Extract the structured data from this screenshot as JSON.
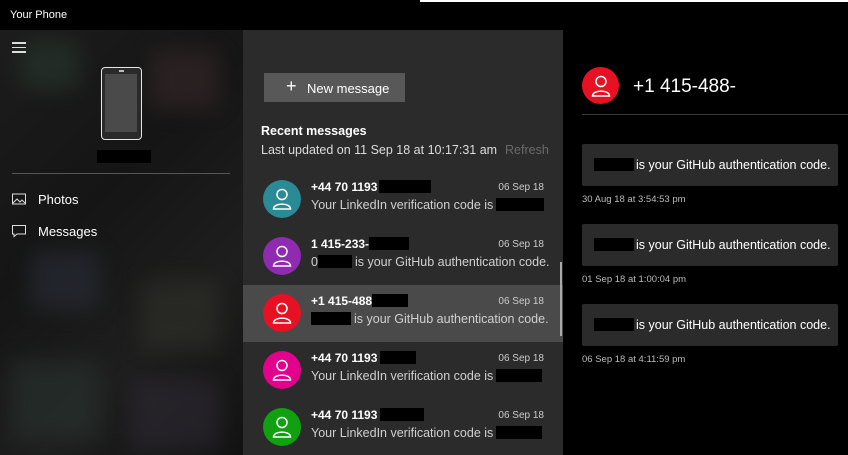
{
  "app": {
    "title": "Your Phone"
  },
  "nav": {
    "items": [
      {
        "label": "Photos",
        "icon": "photos-icon"
      },
      {
        "label": "Messages",
        "icon": "messages-icon"
      }
    ]
  },
  "messages_pane": {
    "new_message_label": "New message",
    "recent_title": "Recent messages",
    "last_updated": "Last updated on 11 Sep 18 at 10:17:31 am",
    "refresh_label": "Refresh",
    "conversations": [
      {
        "name": "+44 70 1193",
        "date": "06 Sep 18",
        "preview": "Your LinkedIn verification code is",
        "preview_suffix": "",
        "avatar_color": "#2a8a96"
      },
      {
        "name": "1 415-233-",
        "date": "06 Sep 18",
        "preview_prefix": "0",
        "preview": "is your GitHub authentication code.",
        "avatar_color": "#8e2bb0"
      },
      {
        "name": "+1 415-488",
        "date": "06 Sep 18",
        "preview": "is your GitHub authentication code.",
        "avatar_color": "#e81123",
        "selected": true
      },
      {
        "name": "+44 70 1193",
        "date": "06 Sep 18",
        "preview": "Your LinkedIn verification code is",
        "avatar_color": "#e3008c"
      },
      {
        "name": "+44 70 1193",
        "date": "06 Sep 18",
        "preview": "Your LinkedIn verification code is",
        "avatar_color": "#10a010"
      }
    ]
  },
  "conversation": {
    "contact": "+1 415-488-",
    "avatar_color": "#e81123",
    "messages": [
      {
        "text": "is your GitHub authentication code.",
        "timestamp": "30 Aug 18 at 3:54:53 pm"
      },
      {
        "text": "is your GitHub authentication code.",
        "timestamp": "01 Sep 18 at 1:00:04 pm"
      },
      {
        "text": "is your GitHub authentication code.",
        "timestamp": "06 Sep 18 at 4:11:59 pm"
      }
    ]
  }
}
